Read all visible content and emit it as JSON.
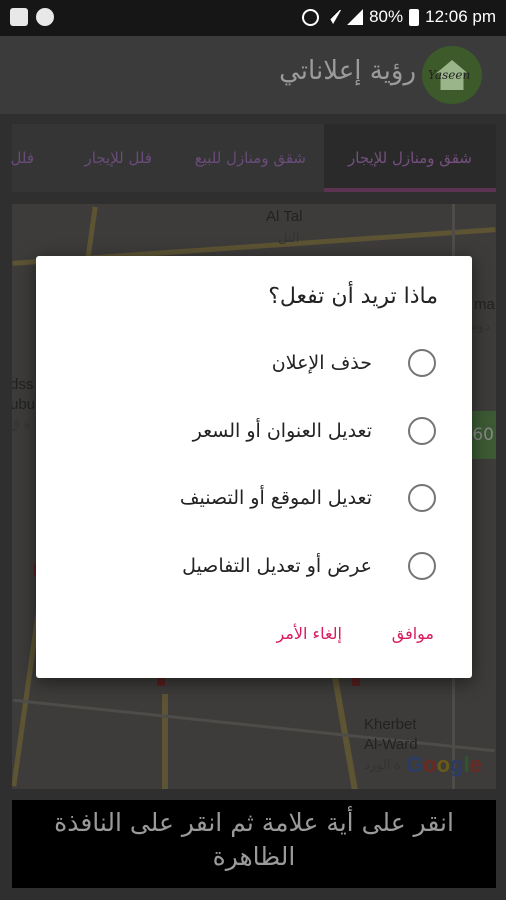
{
  "status_bar": {
    "battery": "80%",
    "time": "12:06 pm",
    "icons": [
      "image-icon",
      "whatsapp-icon",
      "alarm-icon",
      "wifi-icon",
      "signal-icon",
      "battery-icon"
    ]
  },
  "app_bar": {
    "title": "رؤية إعلاناتي",
    "logo_text": "Yaseen"
  },
  "tabs": [
    {
      "label": "شقق ومنازل للإيجار"
    },
    {
      "label": "شقق ومنازل للبيع"
    },
    {
      "label": "فلل للإيجار"
    },
    {
      "label": "فلل"
    }
  ],
  "map": {
    "labels": {
      "al_tal": "Al Tal",
      "al_tal_ar": "التل",
      "ma": "ma",
      "ma_ar": "دوم",
      "dss": "dss",
      "ubu": "ubu",
      "ar_left": "ة ق",
      "kherbet": "Kherbet",
      "alward": "Al-Ward",
      "alward_ar": "ة الورد"
    },
    "badge": "60",
    "google": [
      "G",
      "o",
      "o",
      "g",
      "l",
      "e"
    ]
  },
  "banner": {
    "text": "انقر على أية علامة ثم انقر على النافذة الظاهرة"
  },
  "dialog": {
    "title": "ماذا تريد أن تفعل؟",
    "options": [
      {
        "label": "حذف الإعلان"
      },
      {
        "label": "تعديل العنوان أو السعر"
      },
      {
        "label": "تعديل الموقع أو التصنيف"
      },
      {
        "label": "عرض أو تعديل التفاصيل"
      }
    ],
    "ok": "موافق",
    "cancel": "إلغاء الأمر"
  },
  "colors": {
    "accent": "#d81b60",
    "radio": "#757575"
  }
}
